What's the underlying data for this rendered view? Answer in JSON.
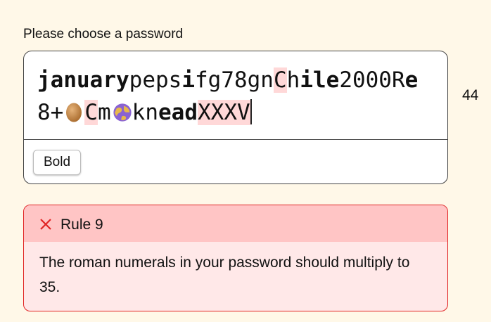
{
  "prompt": "Please choose a password",
  "password": {
    "lines": [
      [
        {
          "text": "january",
          "bold": true,
          "highlight": false
        },
        {
          "text": "peps",
          "bold": false,
          "highlight": false
        },
        {
          "text": "i",
          "bold": true,
          "highlight": false
        },
        {
          "text": "fg78gn",
          "bold": false,
          "highlight": false
        },
        {
          "text": "C",
          "bold": false,
          "highlight": true
        },
        {
          "text": "h",
          "bold": false,
          "highlight": false
        },
        {
          "text": "ile",
          "bold": true,
          "highlight": false
        },
        {
          "text": "2000R",
          "bold": false,
          "highlight": false
        },
        {
          "text": "e",
          "bold": true,
          "highlight": false
        }
      ],
      [
        {
          "text": "8+",
          "bold": false,
          "highlight": false
        },
        {
          "emoji": "egg-icon"
        },
        {
          "text": "C",
          "bold": false,
          "highlight": true
        },
        {
          "text": "m",
          "bold": false,
          "highlight": false
        },
        {
          "emoji": "globe-icon"
        },
        {
          "text": "kn",
          "bold": false,
          "highlight": false
        },
        {
          "text": "ead",
          "bold": true,
          "highlight": false
        },
        {
          "text": "XXXV",
          "bold": false,
          "highlight": true
        }
      ]
    ]
  },
  "toolbar": {
    "bold_label": "Bold"
  },
  "char_count": "44",
  "rule": {
    "title": "Rule 9",
    "status": "failed",
    "status_icon": "close-icon",
    "description": "The roman numerals in your password should multiply to 35.",
    "colors": {
      "border": "#e02424",
      "header": "#ffc5c5",
      "body": "#ffe8e8"
    }
  },
  "colors": {
    "background": "#fff8e8",
    "highlight": "#ffd8d8"
  }
}
